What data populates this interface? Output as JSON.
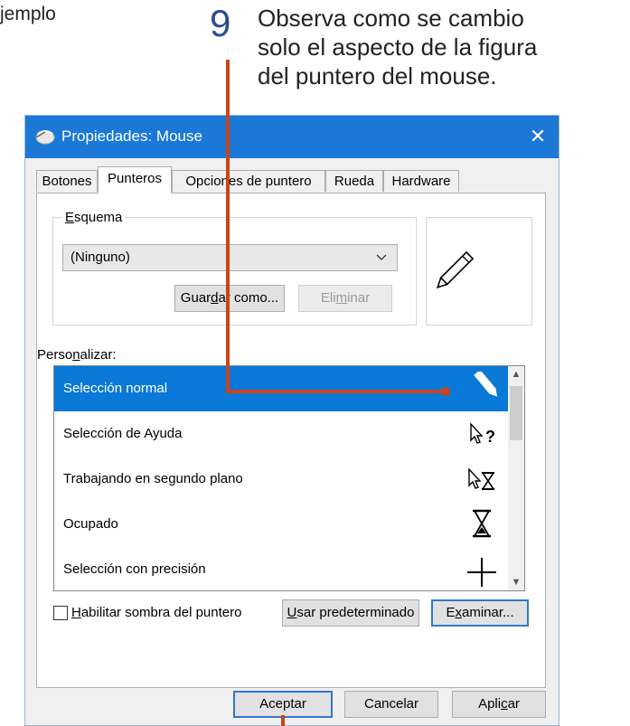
{
  "caption": {
    "prefix": "jemplo",
    "step_number": "9",
    "text_line1": "Observa como se cambio",
    "text_line2": "solo el aspecto de la figura",
    "text_line3": "del puntero del mouse."
  },
  "window": {
    "title": "Propiedades: Mouse",
    "close_icon": "close-icon",
    "tabs": [
      {
        "label": "Botones",
        "active": false
      },
      {
        "label": "Punteros",
        "active": true
      },
      {
        "label": "Opciones de puntero",
        "active": false
      },
      {
        "label": "Rueda",
        "active": false
      },
      {
        "label": "Hardware",
        "active": false
      }
    ]
  },
  "scheme": {
    "label_u": "E",
    "label_rest": "squema",
    "selected": "(Ninguno)",
    "save_as_pre": "Guar",
    "save_as_u": "d",
    "save_as_post": "ar como...",
    "delete_pre": "Eli",
    "delete_u": "m",
    "delete_post": "inar"
  },
  "customize": {
    "label_pre": "Perso",
    "label_u": "n",
    "label_post": "alizar:",
    "items": [
      {
        "label": "Selección normal",
        "icon": "pen-pointer-icon",
        "selected": true
      },
      {
        "label": "Selección de Ayuda",
        "icon": "help-select-icon",
        "selected": false
      },
      {
        "label": "Trabajando en segundo plano",
        "icon": "working-background-icon",
        "selected": false
      },
      {
        "label": "Ocupado",
        "icon": "hourglass-icon",
        "selected": false
      },
      {
        "label": "Selección con precisión",
        "icon": "crosshair-icon",
        "selected": false
      }
    ]
  },
  "shadow": {
    "label_u": "H",
    "label_rest": "abilitar sombra del puntero",
    "checked": false
  },
  "buttons": {
    "use_default_u": "U",
    "use_default_rest": "sar predeterminado",
    "browse_pre": "E",
    "browse_u": "x",
    "browse_post": "aminar...",
    "ok": "Aceptar",
    "cancel": "Cancelar",
    "apply_pre": "Apli",
    "apply_u": "c",
    "apply_post": "ar"
  },
  "colors": {
    "title_bar": "#1b78d7",
    "selection": "#0a78d7",
    "annotation": "#c8441c",
    "step_number": "#2a4d8f"
  }
}
